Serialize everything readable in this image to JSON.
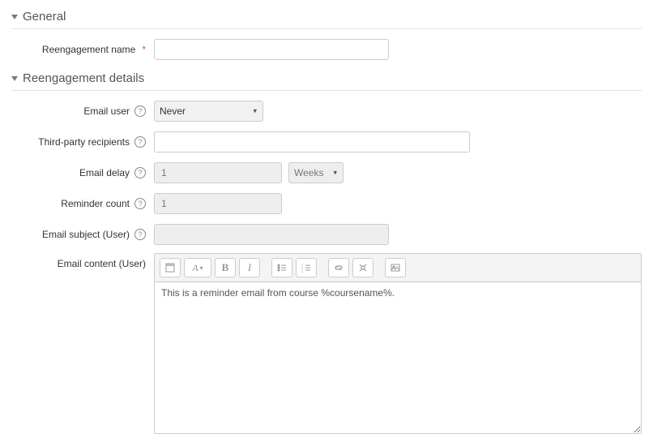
{
  "sections": {
    "general": {
      "title": "General"
    },
    "details": {
      "title": "Reengagement details"
    }
  },
  "labels": {
    "reengagement_name": "Reengagement name",
    "email_user": "Email user",
    "third_party": "Third-party recipients",
    "email_delay": "Email delay",
    "reminder_count": "Reminder count",
    "email_subject_user": "Email subject (User)",
    "email_content_user": "Email content (User)"
  },
  "values": {
    "reengagement_name": "",
    "email_user": "Never",
    "third_party": "",
    "email_delay_qty": "1",
    "email_delay_unit": "Weeks",
    "reminder_count": "1",
    "email_subject_user": "",
    "email_content_user": "This is a reminder email from course %coursename%."
  },
  "required_marker": "*",
  "help_glyph": "?"
}
